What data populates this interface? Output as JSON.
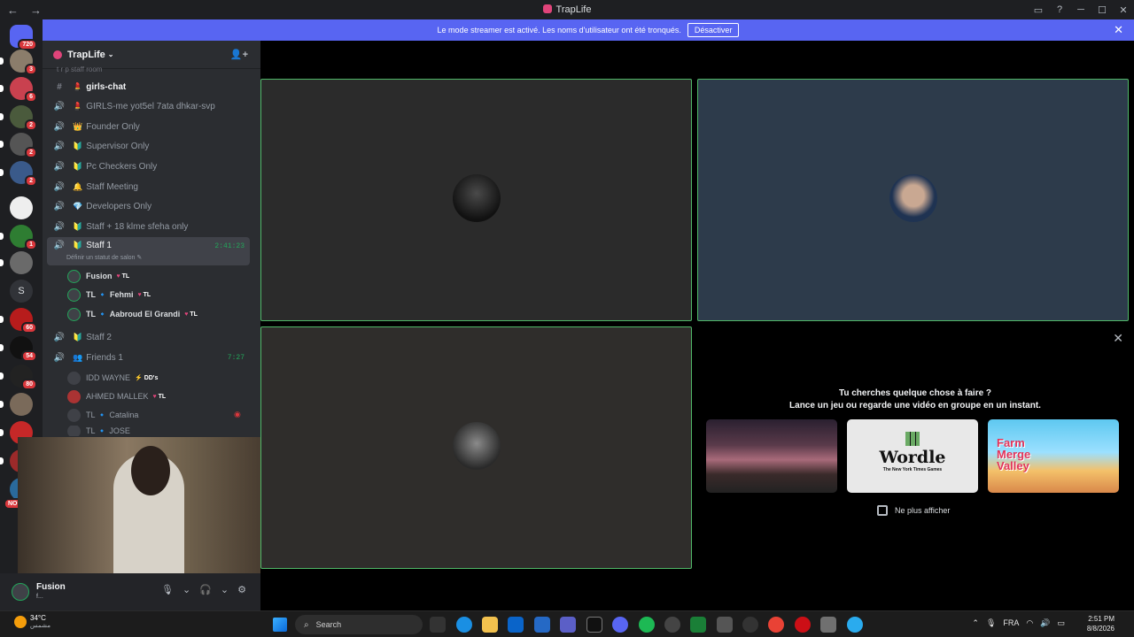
{
  "window": {
    "title": "TrapLife",
    "back_icon": "←",
    "forward_icon": "→",
    "controls": [
      "inbox-icon",
      "help-icon",
      "minimize-icon",
      "maximize-icon",
      "close-icon"
    ]
  },
  "banner": {
    "text": "Le mode streamer est activé. Les noms d'utilisateur ont été tronqués.",
    "button": "Désactiver",
    "close": "✕"
  },
  "servers": {
    "home_badge": "720",
    "badges": [
      "3",
      "6",
      "2",
      "2",
      "2",
      "1",
      "60",
      "54",
      "80"
    ],
    "letter_server": "S",
    "new_label": "NOU"
  },
  "sidebar": {
    "server_name": "TrapLife",
    "header_partial": "t r p staff room",
    "channels": [
      {
        "icon": "#",
        "emoji": "💄",
        "name": "girls-chat"
      },
      {
        "icon": "🔊",
        "emoji": "💄",
        "name": "GIRLS-me yot5el 7ata dhkar-svp"
      },
      {
        "icon": "🔊",
        "emoji": "👑",
        "name": "Founder Only"
      },
      {
        "icon": "🔊",
        "emoji": "🔰",
        "name": "Supervisor Only"
      },
      {
        "icon": "🔊",
        "emoji": "🔰",
        "name": "Pc Checkers Only"
      },
      {
        "icon": "🔊",
        "emoji": "🔔",
        "name": "Staff Meeting"
      },
      {
        "icon": "🔊",
        "emoji": "💎",
        "name": "Developers Only"
      },
      {
        "icon": "🔊",
        "emoji": "🔰",
        "name": "Staff + 18 klme sfeha only"
      },
      {
        "icon": "🔊",
        "emoji": "🔰",
        "name": "Staff 1",
        "timer": "2:41:23",
        "subtitle": "Définir un statut de salon ✎"
      },
      {
        "icon": "🔊",
        "emoji": "🔰",
        "name": "Staff 2"
      },
      {
        "icon": "🔊",
        "emoji": "👥",
        "name": "Friends 1",
        "timer": "7:27"
      }
    ],
    "staff1_users": [
      {
        "name": "Fusion",
        "tag": "TL"
      },
      {
        "name": "TL 🔹 Fehmi",
        "tag": "TL"
      },
      {
        "name": "TL 🔹 Aabroud El Grandi",
        "tag": "TL"
      }
    ],
    "friends1_users": [
      {
        "name": "IDD WAYNE",
        "tag": "DD's"
      },
      {
        "name": "AHMED MALLEK",
        "tag": "TL"
      },
      {
        "name": "TL 🔹 Catalina",
        "tag": ""
      },
      {
        "name": "TL 🔹 JOSE",
        "tag": ""
      }
    ]
  },
  "user_panel": {
    "name": "Fusion",
    "status": "f...",
    "mic_icon": "🎙",
    "headset_icon": "🎧",
    "settings_icon": "⚙"
  },
  "activity": {
    "question": "Tu cherches quelque chose à faire ?",
    "subtitle": "Lance un jeu ou regarde une vidéo en groupe en un instant.",
    "cards": [
      "",
      "Wordle",
      "Farm Merge Valley"
    ],
    "wordle_sub": "The New York Times Games",
    "checkbox": "Ne plus afficher",
    "close": "✕"
  },
  "taskbar": {
    "weather_temp": "34°C",
    "weather_desc": "مشمس",
    "search": "Search",
    "lang": "FRA",
    "time": "2:51 PM",
    "date": "8/8/2026"
  }
}
